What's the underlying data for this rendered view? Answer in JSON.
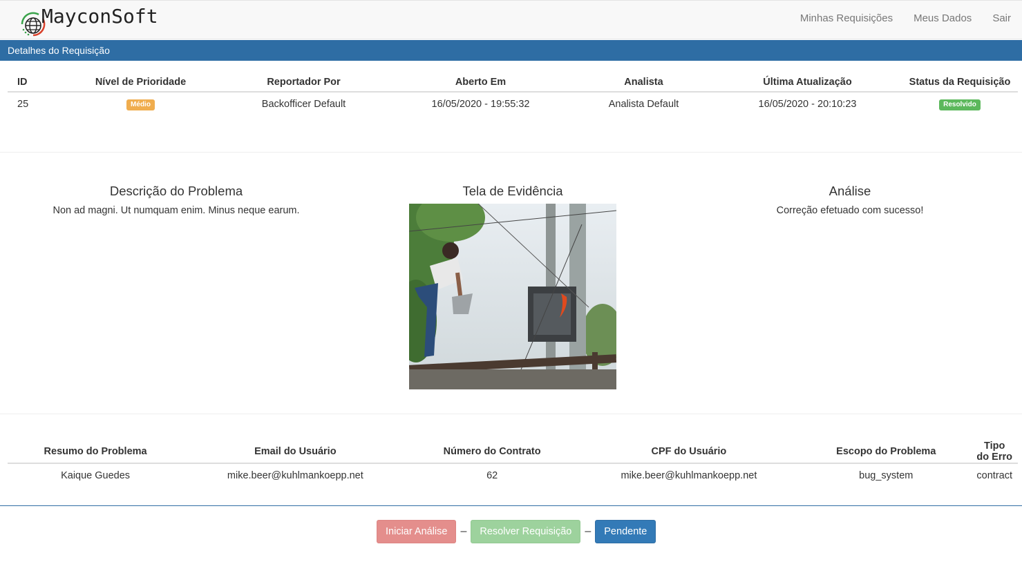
{
  "brand": {
    "name": "MayconSoft"
  },
  "nav": {
    "items": [
      "Minhas Requisições",
      "Meus Dados",
      "Sair"
    ]
  },
  "panel": {
    "title": "Detalhes do Requisição"
  },
  "request_table": {
    "headers": [
      "ID",
      "Nível de Prioridade",
      "Reportador Por",
      "Aberto Em",
      "Analista",
      "Última Atualização",
      "Status da Requisição"
    ],
    "row": {
      "id": "25",
      "priority": "Médio",
      "reporter": "Backofficer Default",
      "opened_at": "16/05/2020 - 19:55:32",
      "analyst": "Analista Default",
      "updated_at": "16/05/2020 - 20:10:23",
      "status": "Resolvido"
    },
    "colors": {
      "priority": "#f0ad4e",
      "status": "#5cb85c"
    }
  },
  "description": {
    "title": "Descrição do Problema",
    "text": "Non ad magni. Ut numquam enim. Minus neque earum."
  },
  "evidence": {
    "title": "Tela de Evidência"
  },
  "analysis": {
    "title": "Análise",
    "text": "Correção efetuado com sucesso!"
  },
  "details_table": {
    "headers": [
      "Resumo do Problema",
      "Email do Usuário",
      "Número do Contrato",
      "CPF do Usuário",
      "Escopo do Problema",
      "Tipo do Erro"
    ],
    "row": [
      "Kaique Guedes",
      "mike.beer@kuhlmankoepp.net",
      "62",
      "mike.beer@kuhlmankoepp.net",
      "bug_system",
      "contract"
    ]
  },
  "actions": {
    "start": "Iniciar Análise",
    "resolve": "Resolver Requisição",
    "pending": "Pendente",
    "separator": "–"
  },
  "colors": {
    "panel": "#2e6da4",
    "danger": "#e48e8c",
    "success": "#9dd29d",
    "primary": "#337ab7"
  }
}
